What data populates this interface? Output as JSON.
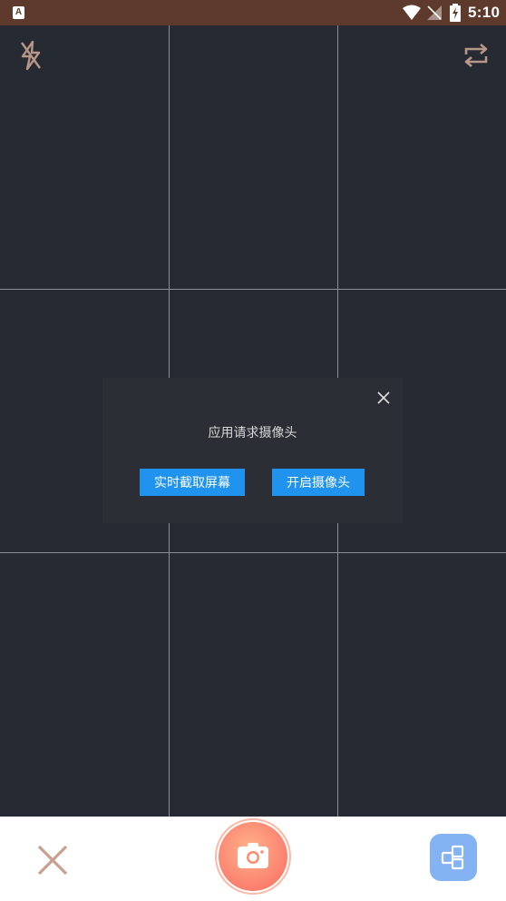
{
  "status_bar": {
    "app_badge": "A",
    "time": "5:10",
    "icons": [
      "wifi-icon",
      "no-signal-icon",
      "battery-charging-icon"
    ]
  },
  "viewfinder": {
    "grid": "3x3",
    "flash_icon": "flash-off-icon",
    "switch_icon": "camera-switch-icon"
  },
  "dialog": {
    "message": "应用请求摄像头",
    "close_icon": "close-icon",
    "buttons": {
      "screen_capture": "实时截取屏幕",
      "open_camera": "开启摄像头"
    },
    "button_color": "#1f93ee"
  },
  "bottom_bar": {
    "close_icon": "close-icon",
    "shutter_icon": "camera-icon",
    "gallery_icon": "gallery-icon",
    "shutter_color": "#fb7f6e",
    "gallery_color": "#84b3f4"
  }
}
